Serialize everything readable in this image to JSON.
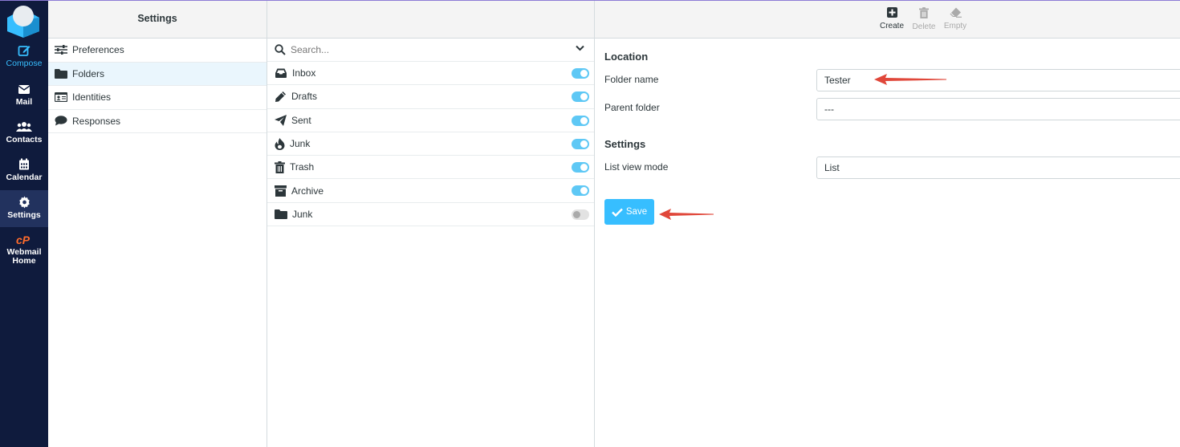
{
  "nav": {
    "compose": "Compose",
    "mail": "Mail",
    "contacts": "Contacts",
    "calendar": "Calendar",
    "settings": "Settings",
    "webmail_line1": "Webmail",
    "webmail_line2": "Home"
  },
  "settings_panel": {
    "title": "Settings",
    "items": [
      {
        "label": "Preferences",
        "icon": "sliders-icon"
      },
      {
        "label": "Folders",
        "icon": "folder-icon"
      },
      {
        "label": "Identities",
        "icon": "id-card-icon"
      },
      {
        "label": "Responses",
        "icon": "comment-icon"
      }
    ]
  },
  "folders_panel": {
    "search_placeholder": "Search...",
    "folders": [
      {
        "label": "Inbox",
        "subscribed": true
      },
      {
        "label": "Drafts",
        "subscribed": true
      },
      {
        "label": "Sent",
        "subscribed": true
      },
      {
        "label": "Junk",
        "subscribed": true
      },
      {
        "label": "Trash",
        "subscribed": true
      },
      {
        "label": "Archive",
        "subscribed": true
      },
      {
        "label": "Junk",
        "subscribed": false
      }
    ]
  },
  "toolbar": {
    "create": "Create",
    "delete": "Delete",
    "empty": "Empty"
  },
  "form": {
    "location_heading": "Location",
    "folder_name_label": "Folder name",
    "folder_name_value": "Tester",
    "parent_folder_label": "Parent folder",
    "parent_folder_value": "---",
    "settings_heading": "Settings",
    "list_view_label": "List view mode",
    "list_view_value": "List",
    "save_label": "Save"
  },
  "colors": {
    "nav_bg": "#0f1b3d",
    "accent": "#37beff",
    "annotation_arrow": "#e0473a"
  }
}
